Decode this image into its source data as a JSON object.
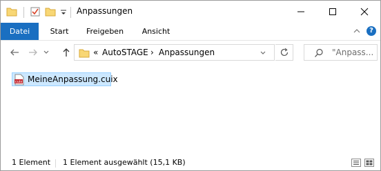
{
  "window": {
    "title": "Anpassungen",
    "minimize_icon": "minimize-icon",
    "maximize_icon": "maximize-icon",
    "close_icon": "close-icon"
  },
  "quick_access": [
    "folder-icon",
    "properties-checkmark-icon",
    "new-folder-icon",
    "customize-dropdown-icon"
  ],
  "ribbon": {
    "tabs": [
      {
        "label": "Datei",
        "active": true
      },
      {
        "label": "Start",
        "active": false
      },
      {
        "label": "Freigeben",
        "active": false
      },
      {
        "label": "Ansicht",
        "active": false
      }
    ],
    "help_label": "?"
  },
  "navigation": {
    "back_icon": "back-arrow-icon",
    "forward_icon": "forward-arrow-icon",
    "recent_icon": "chevron-down-icon",
    "up_icon": "up-arrow-icon",
    "address": {
      "overflow": "«",
      "crumbs": [
        "AutoSTAGE",
        "Anpassungen"
      ],
      "separator": "›"
    },
    "refresh_icon": "refresh-icon",
    "search_placeholder": "\"Anpass..."
  },
  "content": {
    "items": [
      {
        "name": "MeineAnpassung.cuix",
        "icon": "cuix-file-icon",
        "selected": true
      }
    ]
  },
  "statusbar": {
    "count": "1 Element",
    "selection": "1 Element ausgewählt (15,1 KB)"
  },
  "colors": {
    "accent": "#1a6fc1",
    "selection_bg": "#cce8ff",
    "selection_border": "#99d1ff",
    "folder": "#f8d775"
  }
}
